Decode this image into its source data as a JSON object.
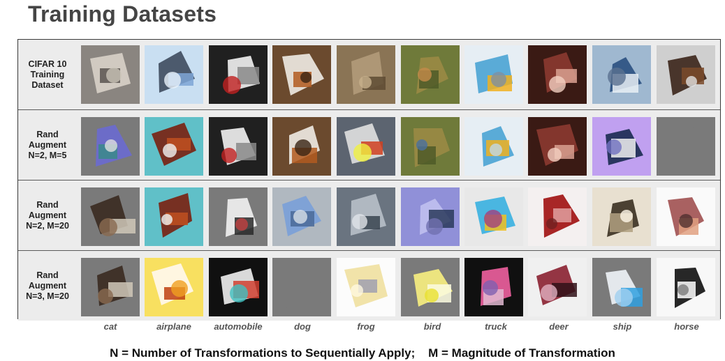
{
  "title": "Training Datasets",
  "rows": [
    {
      "label": "CIFAR 10\nTraining\nDataset"
    },
    {
      "label": "Rand\nAugment\nN=2, M=5"
    },
    {
      "label": "Rand\nAugment\nN=2, M=20"
    },
    {
      "label": "Rand\nAugment\nN=3, M=20"
    }
  ],
  "classes": [
    "cat",
    "airplane",
    "automobile",
    "dog",
    "frog",
    "bird",
    "truck",
    "deer",
    "ship",
    "horse"
  ],
  "footnote": "N = Number of Transformations to Sequentially Apply;    M = Magnitude of Transformation"
}
